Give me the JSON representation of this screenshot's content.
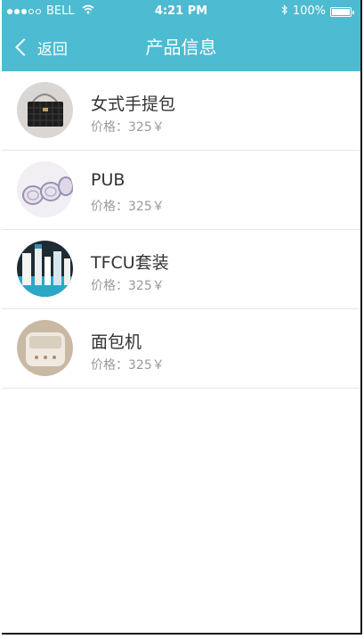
{
  "status_bar": {
    "carrier": "BELL",
    "time": "4:21 PM",
    "battery": "100%",
    "signal_icon": "signal-dots-icon",
    "wifi_icon": "wifi-icon",
    "bluetooth_icon": "bluetooth-icon",
    "battery_icon": "battery-icon"
  },
  "navbar": {
    "back_label": "返回",
    "back_icon": "chevron-left-icon",
    "title": "产品信息"
  },
  "products": [
    {
      "name": "女式手提包",
      "price": "价格：325￥",
      "image": "handbag-photo"
    },
    {
      "name": "PUB",
      "price": "价格：325￥",
      "image": "cups-photo"
    },
    {
      "name": "TFCU套装",
      "price": "价格：325￥",
      "image": "cosmetics-set-photo"
    },
    {
      "name": "面包机",
      "price": "价格：325￥",
      "image": "bread-machine-photo"
    }
  ],
  "colors": {
    "header_background": "#4dbbd1",
    "header_text": "#ffffff",
    "name_text": "#333333",
    "price_text": "#9a9a9a",
    "divider": "#e6e6e6"
  }
}
